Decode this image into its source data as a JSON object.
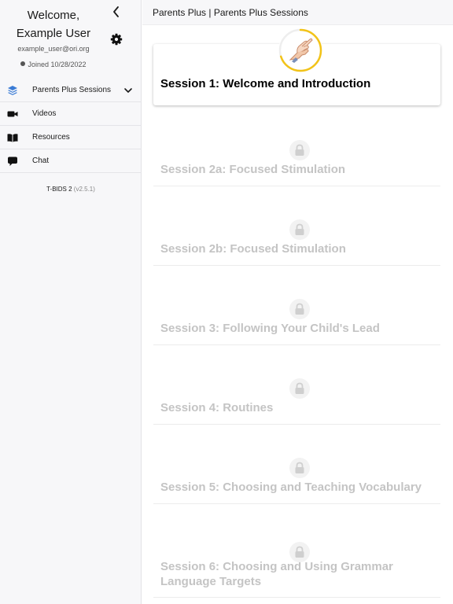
{
  "sidebar": {
    "welcome_line1": "Welcome,",
    "welcome_line2": "Example User",
    "email": "example_user@ori.org",
    "joined": "Joined 10/28/2022",
    "nav": [
      {
        "label": "Parents Plus Sessions",
        "icon": "layers-icon",
        "active": true,
        "expandable": true
      },
      {
        "label": "Videos",
        "icon": "video-camera-icon"
      },
      {
        "label": "Resources",
        "icon": "open-book-icon"
      },
      {
        "label": "Chat",
        "icon": "chat-bubble-icon"
      }
    ],
    "version_name": "T-BIDS 2",
    "version_number": "(v2.5.1)"
  },
  "header": {
    "title": "Parents Plus | Parents Plus Sessions"
  },
  "sessions": [
    {
      "title": "Session 1: Welcome and Introduction",
      "locked": false,
      "progress": 0.7
    },
    {
      "title": "Session 2a: Focused Stimulation",
      "locked": true
    },
    {
      "title": "Session 2b: Focused Stimulation",
      "locked": true
    },
    {
      "title": "Session 3: Following Your Child's Lead",
      "locked": true
    },
    {
      "title": "Session 4: Routines",
      "locked": true
    },
    {
      "title": "Session 5: Choosing and Teaching Vocabulary",
      "locked": true
    },
    {
      "title": "Session 6: Choosing and Using Grammar Language Targets",
      "locked": true
    }
  ],
  "colors": {
    "accent_blue": "#3a7bd5",
    "progress_yellow": "#f2c318",
    "locked_text": "#c4c4c4"
  }
}
